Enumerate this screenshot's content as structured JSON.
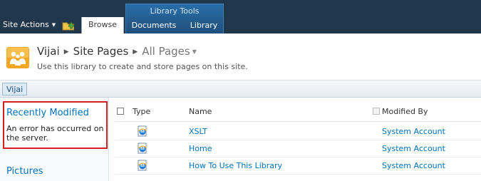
{
  "ribbon": {
    "site_actions": "Site Actions",
    "context_group_title": "Library Tools",
    "tabs": [
      {
        "label": "Browse",
        "selected": true
      },
      {
        "label": "Documents",
        "selected": false
      },
      {
        "label": "Library",
        "selected": false
      }
    ],
    "colors": {
      "bar": "#21374c",
      "context_group": "#2a6ea8"
    }
  },
  "title_area": {
    "breadcrumb": [
      "Vijai",
      "Site Pages",
      "All Pages"
    ],
    "description": "Use this library to create and store pages on this site."
  },
  "top_nav": {
    "items": [
      "Vijai"
    ]
  },
  "left_nav": {
    "recently_modified": {
      "title": "Recently Modified",
      "error": "An error has occurred on the server."
    },
    "items": [
      "Pictures"
    ]
  },
  "list": {
    "columns": {
      "type": "Type",
      "name": "Name",
      "modified_by": "Modified By"
    },
    "rows": [
      {
        "icon": "ie-page-icon",
        "name": "XSLT",
        "modified_by": "System Account"
      },
      {
        "icon": "ie-page-icon",
        "name": "Home",
        "modified_by": "System Account"
      },
      {
        "icon": "ie-page-icon",
        "name": "How To Use This Library",
        "modified_by": "System Account"
      }
    ]
  },
  "colors": {
    "link": "#0072bc",
    "highlight_border": "#d22224"
  }
}
